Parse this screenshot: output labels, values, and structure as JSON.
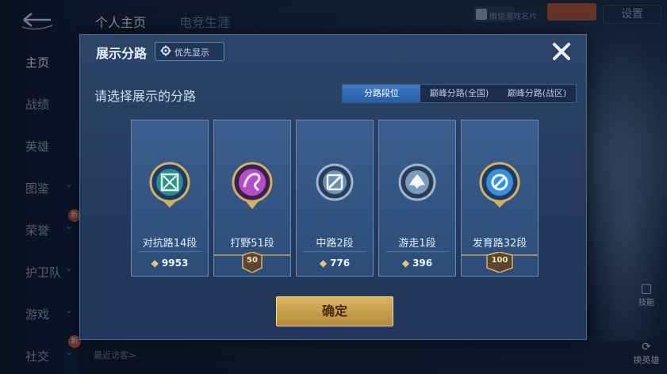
{
  "background": {
    "sidebar_items": [
      {
        "label": "主页",
        "active": true,
        "chevron": false,
        "badge": ""
      },
      {
        "label": "战绩",
        "active": false,
        "chevron": false,
        "badge": ""
      },
      {
        "label": "英雄",
        "active": false,
        "chevron": false,
        "badge": ""
      },
      {
        "label": "图鉴",
        "active": false,
        "chevron": true,
        "badge": ""
      },
      {
        "label": "荣誉",
        "active": false,
        "chevron": true,
        "badge": "新"
      },
      {
        "label": "护卫队",
        "active": false,
        "chevron": true,
        "badge": ""
      },
      {
        "label": "游戏",
        "active": false,
        "chevron": true,
        "badge": ""
      },
      {
        "label": "社交",
        "active": false,
        "chevron": true,
        "badge": "新"
      }
    ],
    "top_tabs": [
      "个人主页",
      "电竞生涯"
    ],
    "user_chip": "微信游戏名片",
    "settings_label": "设置",
    "recent_visitors_label": "最近访客>",
    "right_btn_1": "技能",
    "right_btn_2": "换英雄"
  },
  "dialog": {
    "title": "展示分路",
    "priority_label": "优先显示",
    "subtitle": "请选择展示的分路",
    "tabs": [
      {
        "label": "分路段位",
        "active": true
      },
      {
        "label": "巅峰分路(全国)",
        "active": false
      },
      {
        "label": "巅峰分路(战区)",
        "active": false
      }
    ],
    "cards": [
      {
        "label": "对抗路14段",
        "points": "9953",
        "star": "",
        "emblem": "clash-lane-icon",
        "color": "#3fd0b4"
      },
      {
        "label": "打野51段",
        "points": "",
        "star": "50",
        "emblem": "jungle-icon",
        "color": "#c960d4"
      },
      {
        "label": "中路2段",
        "points": "776",
        "star": "",
        "emblem": "mid-lane-icon",
        "color": "#8fb8de"
      },
      {
        "label": "游走1段",
        "points": "396",
        "star": "",
        "emblem": "roam-icon",
        "color": "#9ec0dc"
      },
      {
        "label": "发育路32段",
        "points": "",
        "star": "100",
        "emblem": "farm-lane-icon",
        "color": "#4aa6e6"
      }
    ],
    "confirm_label": "确定"
  },
  "colors": {
    "accent": "#2a5ea6",
    "gold": "#d9b663",
    "panel": "#2c456a"
  }
}
